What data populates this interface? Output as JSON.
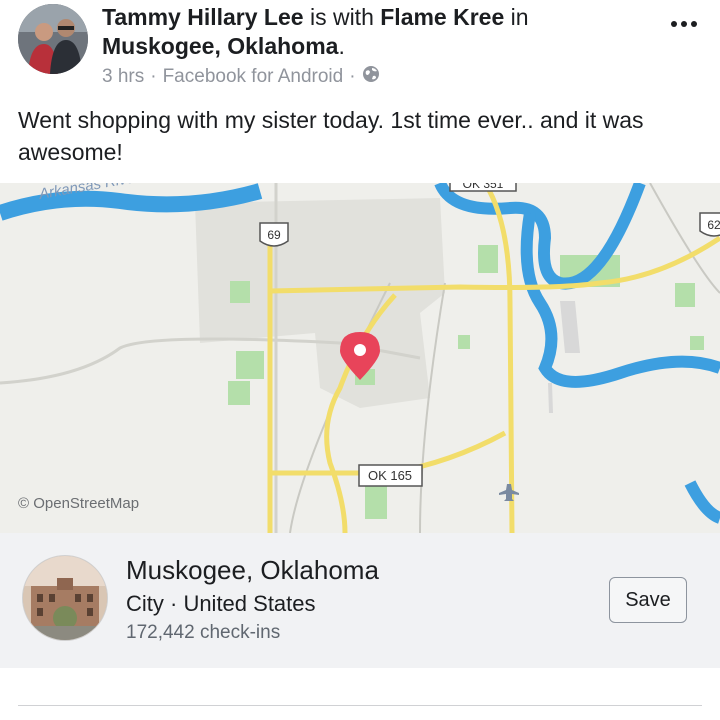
{
  "post": {
    "author": "Tammy Hillary Lee",
    "with_text": " is with ",
    "with_name": "Flame Kree",
    "in_text": " in",
    "location": "Muskogee, Oklahoma",
    "location_suffix": ".",
    "time": "3 hrs",
    "separator": "·",
    "source": "Facebook for Android",
    "privacy_icon": "globe-icon",
    "more_icon": "more-dots-icon",
    "text": "Went shopping with my sister today. 1st time ever.. and it was awesome!"
  },
  "map": {
    "attribution": "© OpenStreetMap",
    "labels": {
      "river": "Arkansas River",
      "hwy69": "69",
      "hwy62": "62",
      "ok165": "OK 165",
      "ok351": "OK 351"
    },
    "pin_icon": "map-pin-icon",
    "colors": {
      "water": "#3d9fe0",
      "road": "#f2dd6a",
      "park": "#a8dca0",
      "urban": "#e2e2dd",
      "pin": "#e8445a"
    }
  },
  "place": {
    "name": "Muskogee, Oklahoma",
    "type": "City · United States",
    "checkins": "172,442 check-ins",
    "save_label": "Save"
  }
}
